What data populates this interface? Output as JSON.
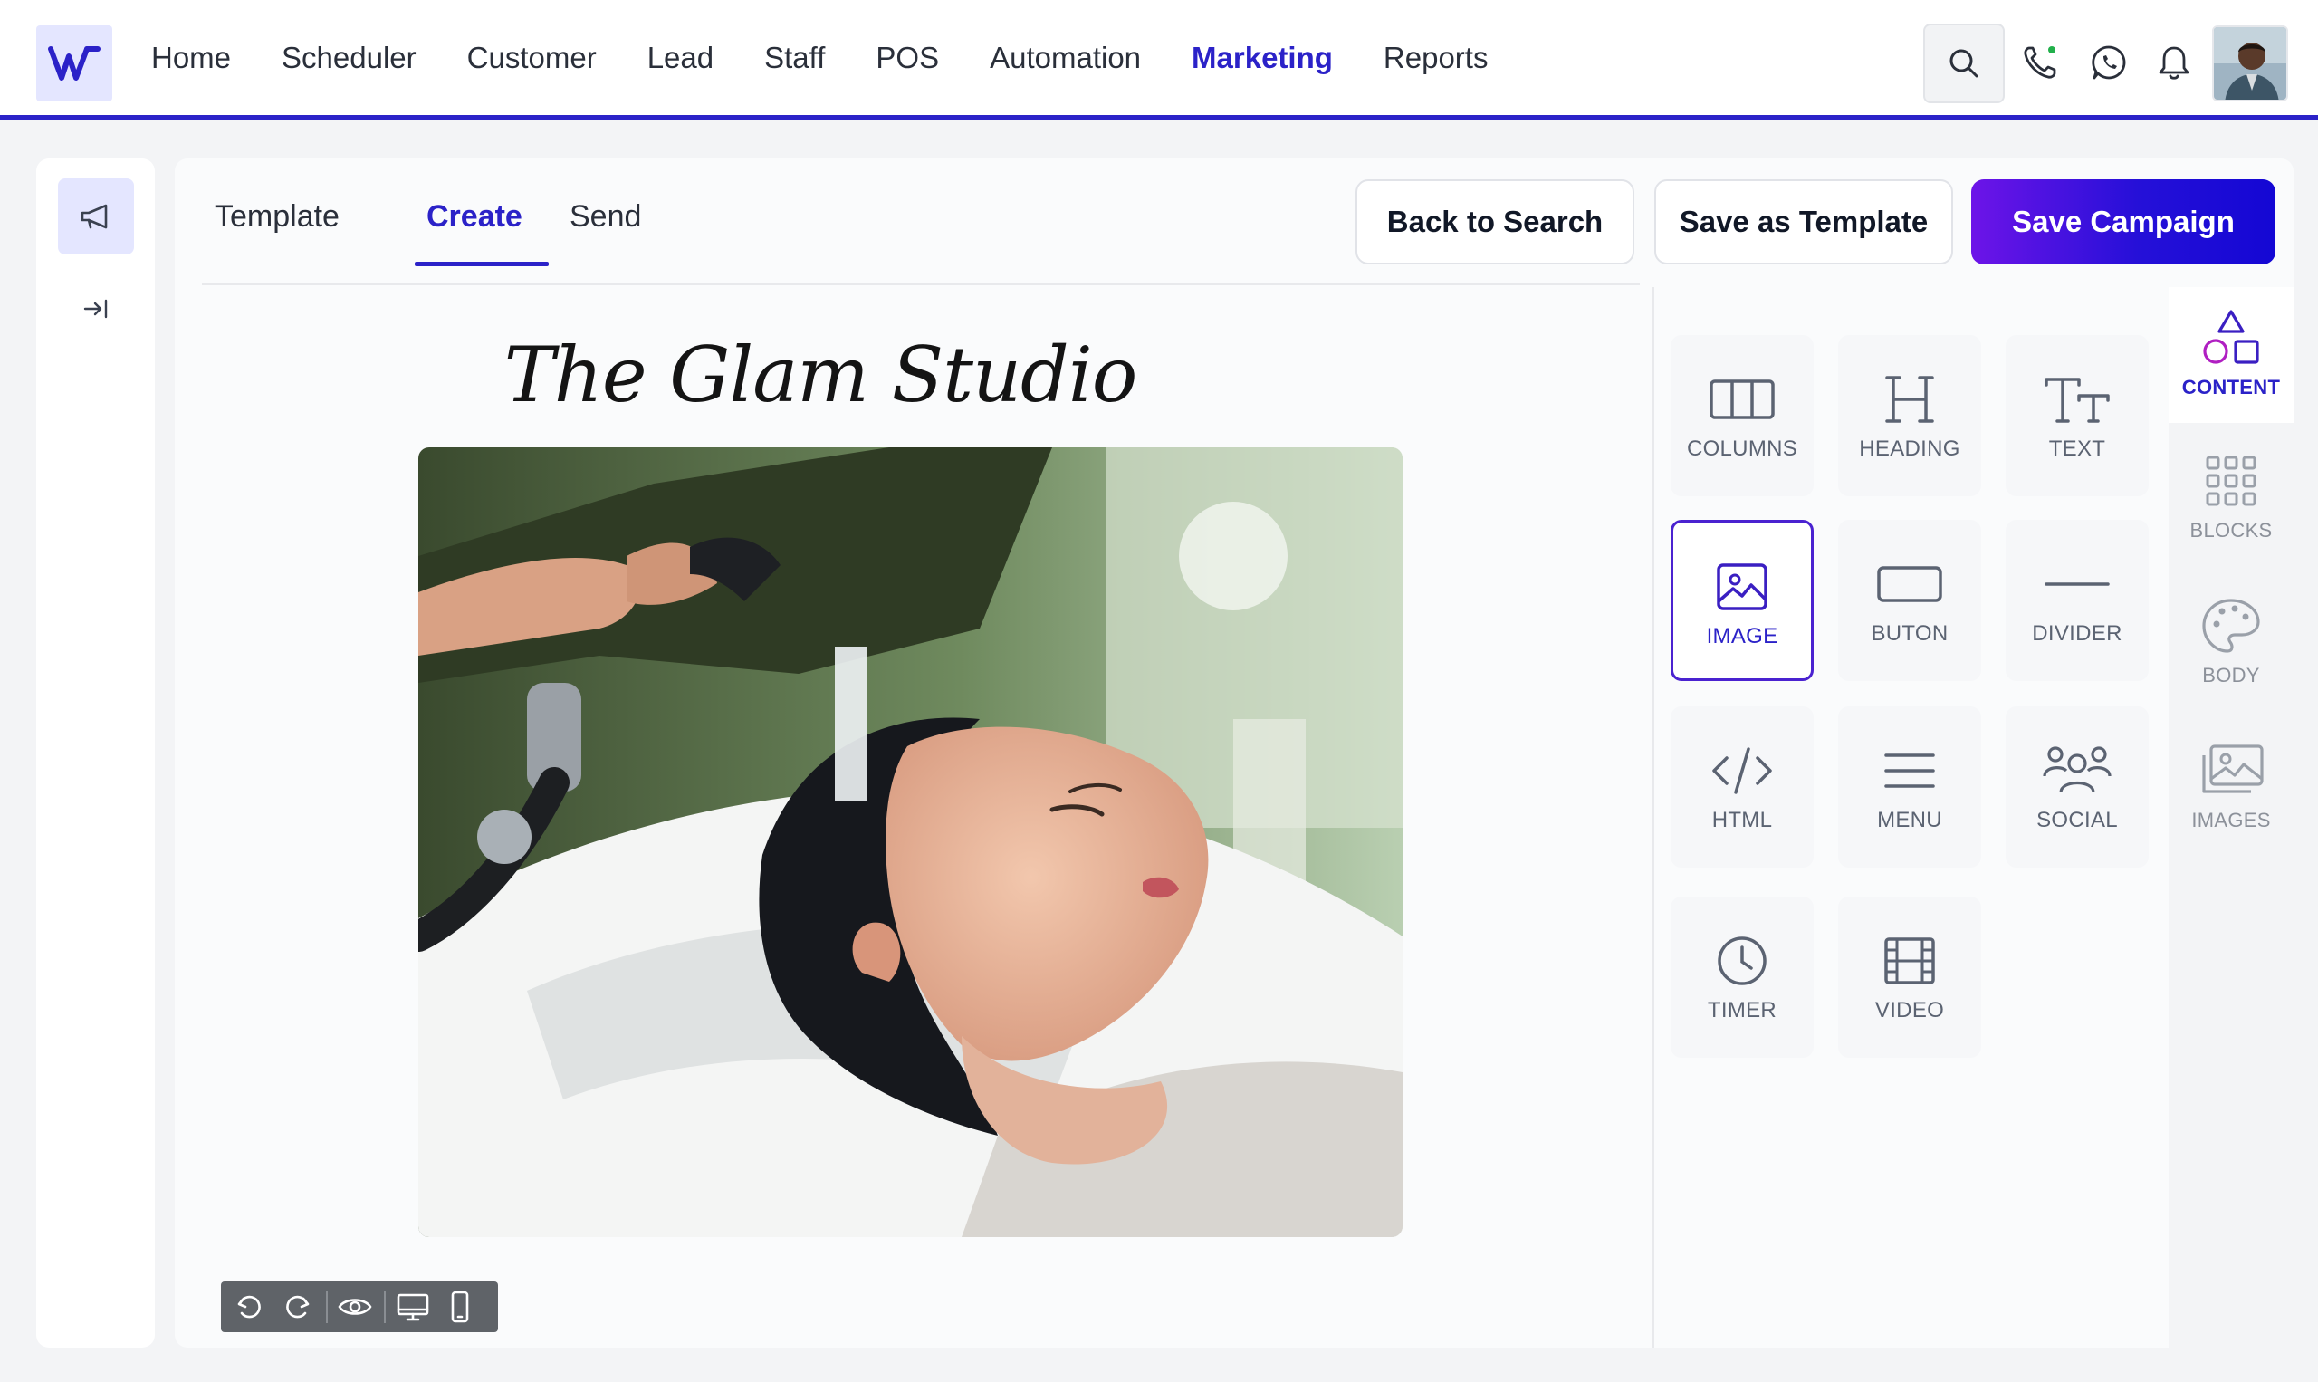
{
  "nav": {
    "items": [
      {
        "label": "Home"
      },
      {
        "label": "Scheduler"
      },
      {
        "label": "Customer"
      },
      {
        "label": "Lead"
      },
      {
        "label": "Staff"
      },
      {
        "label": "POS"
      },
      {
        "label": "Automation"
      },
      {
        "label": "Marketing",
        "active": true
      },
      {
        "label": "Reports"
      }
    ]
  },
  "header_icons": [
    "search-icon",
    "phone-icon",
    "whatsapp-icon",
    "bell-icon",
    "avatar"
  ],
  "tabs": [
    {
      "label": "Template"
    },
    {
      "label": "Create",
      "active": true
    },
    {
      "label": "Send"
    }
  ],
  "actions": {
    "back": "Back to Search",
    "save_template": "Save as Template",
    "save_campaign": "Save Campaign"
  },
  "canvas": {
    "title": "The Glam Studio",
    "toolbar_icons": [
      "undo-icon",
      "redo-icon",
      "preview-icon",
      "desktop-icon",
      "mobile-icon"
    ]
  },
  "tools": [
    {
      "label": "COLUMNS",
      "icon": "columns-icon"
    },
    {
      "label": "HEADING",
      "icon": "heading-icon"
    },
    {
      "label": "TEXT",
      "icon": "text-icon"
    },
    {
      "label": "IMAGE",
      "icon": "image-icon",
      "selected": true
    },
    {
      "label": "BUTON",
      "icon": "button-icon"
    },
    {
      "label": "DIVIDER",
      "icon": "divider-icon"
    },
    {
      "label": "HTML",
      "icon": "code-icon"
    },
    {
      "label": "MENU",
      "icon": "menu-icon"
    },
    {
      "label": "SOCIAL",
      "icon": "social-icon"
    },
    {
      "label": "TIMER",
      "icon": "clock-icon"
    },
    {
      "label": "VIDEO",
      "icon": "film-icon"
    }
  ],
  "side_tabs": [
    {
      "label": "CONTENT",
      "icon": "shapes-icon",
      "active": true
    },
    {
      "label": "BLOCKS",
      "icon": "grid-icon"
    },
    {
      "label": "BODY",
      "icon": "palette-icon"
    },
    {
      "label": "IMAGES",
      "icon": "images-icon"
    }
  ],
  "colors": {
    "accent": "#2b22c8",
    "accent_gradient_start": "#6d14e8",
    "logo_bg": "#e4e6ff"
  }
}
